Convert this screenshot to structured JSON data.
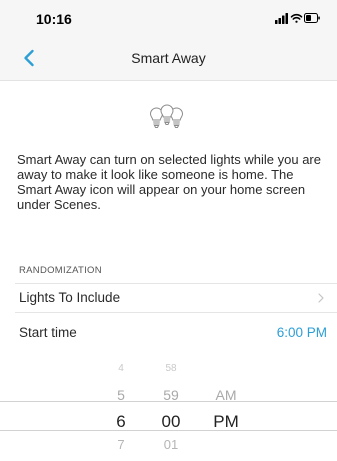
{
  "status_bar": {
    "time": "10:16"
  },
  "nav": {
    "title": "Smart Away"
  },
  "description": "Smart Away can turn on selected lights while you are away to make it look like someone is home. The Smart Away icon will appear on your home screen under Scenes.",
  "section_header": "RANDOMIZATION",
  "rows": {
    "lights_to_include": {
      "label": "Lights To Include"
    },
    "start_time": {
      "label": "Start time",
      "value": "6:00 PM"
    }
  },
  "picker": {
    "hours": [
      "4",
      "5",
      "6",
      "7"
    ],
    "minutes": [
      "58",
      "59",
      "00",
      "01"
    ],
    "ampm": [
      "AM",
      "PM"
    ]
  },
  "colors": {
    "accent": "#2e9ed6",
    "nav_background": "#f6f6f6"
  },
  "icons": [
    "back-chevron-icon",
    "light-bulbs-icon",
    "chevron-right-icon",
    "signal-icon",
    "wifi-icon",
    "battery-icon"
  ]
}
